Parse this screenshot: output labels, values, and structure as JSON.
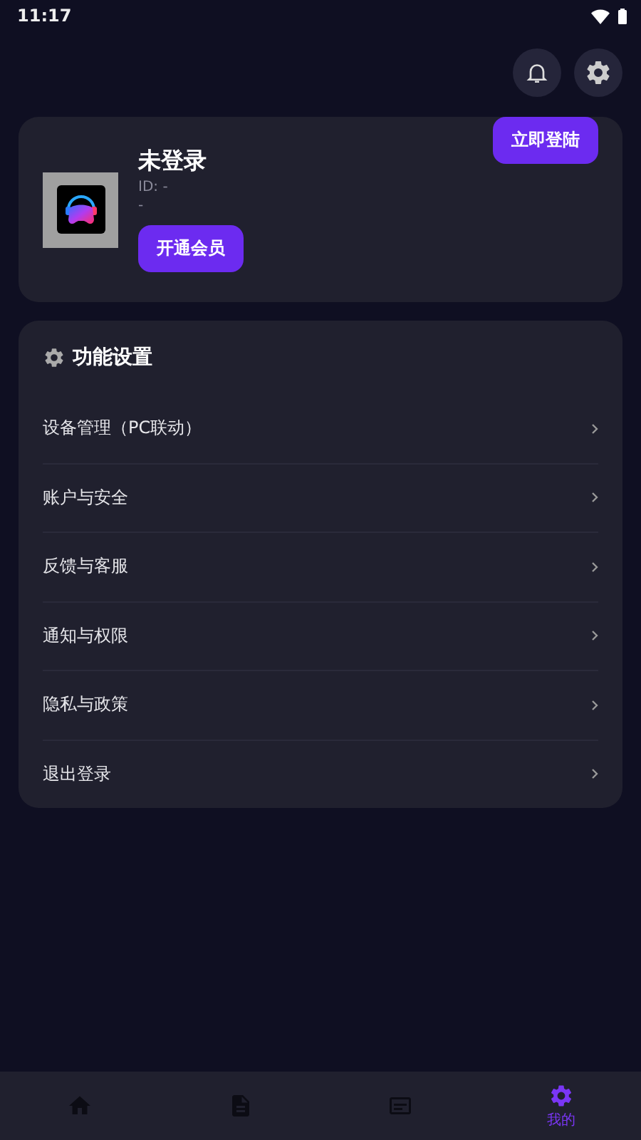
{
  "status_bar": {
    "time": "11:17"
  },
  "profile": {
    "name": "未登录",
    "id": "ID: -",
    "subtitle": "-",
    "vip_button": "开通会员",
    "login_button": "立即登陆"
  },
  "settings": {
    "title": "功能设置",
    "items": [
      {
        "label": "设备管理（PC联动）"
      },
      {
        "label": "账户与安全"
      },
      {
        "label": "反馈与客服"
      },
      {
        "label": "通知与权限"
      },
      {
        "label": "隐私与政策"
      },
      {
        "label": "退出登录"
      }
    ]
  },
  "nav": [
    {
      "kind": "home",
      "selected": false
    },
    {
      "kind": "document",
      "selected": false
    },
    {
      "kind": "message",
      "selected": false
    },
    {
      "kind": "gear",
      "label": "我的",
      "selected": true
    }
  ]
}
